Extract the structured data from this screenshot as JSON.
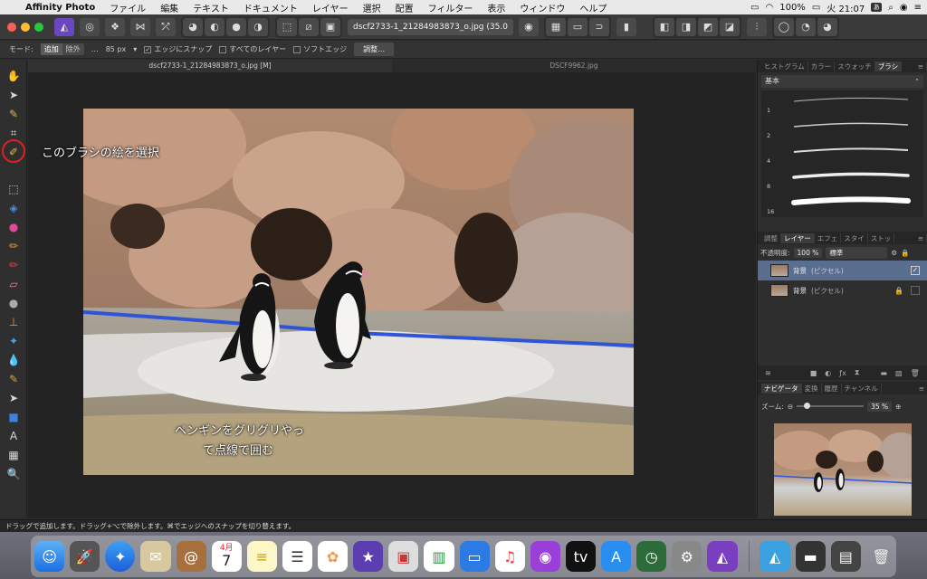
{
  "menubar": {
    "apple": "",
    "items": [
      "Affinity Photo",
      "ファイル",
      "編集",
      "テキスト",
      "ドキュメント",
      "レイヤー",
      "選択",
      "配置",
      "フィルター",
      "表示",
      "ウィンドウ",
      "ヘルプ"
    ],
    "battery": "100%",
    "clock": "火 21:07",
    "input_method": "あ"
  },
  "toolbar": {
    "document_selector": "dscf2733-1_21284983873_o.jpg (35.0"
  },
  "context_bar": {
    "mode_label": "モード:",
    "mode_add": "追加",
    "mode_subtract": "除外",
    "width_prefix": "…",
    "width_value": "85 px",
    "snap_edges": "エッジにスナップ",
    "all_layers": "すべてのレイヤー",
    "soft_edge": "ソフトエッジ",
    "refine_button": "調整…"
  },
  "tabs": {
    "active": "dscf2733-1_21284983873_o.jpg [M]",
    "other": "DSCF9962.jpg"
  },
  "annotations": {
    "select_brush": "このブラシの絵を選択",
    "instruction_line1": "ペンギンをグリグリやっ",
    "instruction_line2": "て点線で囲む"
  },
  "brush_panel": {
    "tabs": [
      "ヒストグラム",
      "カラー",
      "スウォッチ",
      "ブラシ"
    ],
    "category": "基本",
    "sizes": [
      "1",
      "2",
      "4",
      "8",
      "16"
    ]
  },
  "layers_panel": {
    "tabs": [
      "調整",
      "レイヤー",
      "エフェ",
      "スタイ",
      "ストッ"
    ],
    "opacity_label": "不透明度:",
    "opacity_value": "100 %",
    "blend_mode": "標準",
    "layers": [
      {
        "name": "背景",
        "type": "(ピクセル)",
        "selected": true
      },
      {
        "name": "背景",
        "type": "(ピクセル)",
        "selected": false
      }
    ]
  },
  "navigator_panel": {
    "tabs": [
      "ナビゲータ",
      "変換",
      "履歴",
      "チャンネル"
    ],
    "zoom_label": "ズーム:",
    "zoom_value": "35 %"
  },
  "status_bar": {
    "text": "ドラッグで追加します。ドラッグ+⌥で除外します。⌘でエッジへのスナップを切り替えます。"
  },
  "dock": {
    "calendar_month": "4月",
    "calendar_day": "7"
  }
}
